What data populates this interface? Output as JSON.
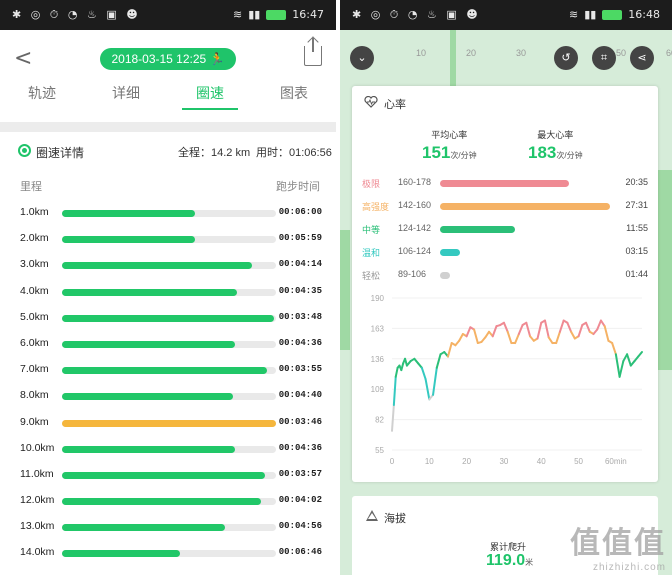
{
  "left": {
    "status_time": "16:47",
    "datetime": "2018-03-15 12:25",
    "tabs": [
      {
        "label": "轨迹",
        "active": false
      },
      {
        "label": "详细",
        "active": false
      },
      {
        "label": "圈速",
        "active": true
      },
      {
        "label": "图表",
        "active": false
      }
    ],
    "summary": {
      "title": "圈速详情",
      "total": "全程：14.2 km",
      "duration": "用时：01:06:56"
    },
    "col_left": "里程",
    "col_right": "跑步时间",
    "laps": [
      {
        "km": "1.0km",
        "time": "00:06:00",
        "pct": 62,
        "slow": false
      },
      {
        "km": "2.0km",
        "time": "00:05:59",
        "pct": 62,
        "slow": false
      },
      {
        "km": "3.0km",
        "time": "00:04:14",
        "pct": 89,
        "slow": false
      },
      {
        "km": "4.0km",
        "time": "00:04:35",
        "pct": 82,
        "slow": false
      },
      {
        "km": "5.0km",
        "time": "00:03:48",
        "pct": 99,
        "slow": false
      },
      {
        "km": "6.0km",
        "time": "00:04:36",
        "pct": 81,
        "slow": false
      },
      {
        "km": "7.0km",
        "time": "00:03:55",
        "pct": 96,
        "slow": false
      },
      {
        "km": "8.0km",
        "time": "00:04:40",
        "pct": 80,
        "slow": false
      },
      {
        "km": "9.0km",
        "time": "00:03:46",
        "pct": 100,
        "slow": true
      },
      {
        "km": "10.0km",
        "time": "00:04:36",
        "pct": 81,
        "slow": false
      },
      {
        "km": "11.0km",
        "time": "00:03:57",
        "pct": 95,
        "slow": false
      },
      {
        "km": "12.0km",
        "time": "00:04:02",
        "pct": 93,
        "slow": false
      },
      {
        "km": "13.0km",
        "time": "00:04:56",
        "pct": 76,
        "slow": false
      },
      {
        "km": "14.0km",
        "time": "00:06:46",
        "pct": 55,
        "slow": false
      }
    ]
  },
  "right": {
    "status_time": "16:48",
    "map_ticks": [
      "10",
      "20",
      "30",
      "40",
      "50",
      "60"
    ],
    "hr_title": "心率",
    "avg_label": "平均心率",
    "avg_value": "151",
    "max_label": "最大心率",
    "max_value": "183",
    "unit": "次/分钟",
    "zones": [
      {
        "name": "极限",
        "range": "160-178",
        "time": "20:35",
        "pct": 76,
        "color": "#ef8a93"
      },
      {
        "name": "高强度",
        "range": "142-160",
        "time": "27:31",
        "pct": 100,
        "color": "#f5b265"
      },
      {
        "name": "中等",
        "range": "124-142",
        "time": "11:55",
        "pct": 44,
        "color": "#2bbf78"
      },
      {
        "name": "温和",
        "range": "106-124",
        "time": "03:15",
        "pct": 12,
        "color": "#34c9c0"
      },
      {
        "name": "轻松",
        "range": "89-106",
        "time": "01:44",
        "pct": 6,
        "color": "#d0d0d0"
      }
    ],
    "chart_data": {
      "type": "line",
      "title": "",
      "xlabel": "",
      "ylabel": "",
      "x_ticks": [
        "0",
        "10",
        "20",
        "30",
        "40",
        "50",
        "60min"
      ],
      "y_ticks": [
        "190",
        "163",
        "136",
        "109",
        "82",
        "55"
      ],
      "ylim": [
        55,
        190
      ],
      "xlim": [
        0,
        67
      ],
      "series": [
        {
          "x": [
            0,
            0.5,
            1,
            1.5,
            2,
            2.5,
            3,
            3.5,
            4,
            5,
            6,
            7,
            8,
            9,
            10,
            11,
            12,
            13,
            14,
            15,
            16,
            17,
            18,
            19,
            20,
            21,
            22,
            23,
            24,
            25,
            26,
            27,
            28,
            29,
            30,
            31,
            32,
            33,
            34,
            35,
            36,
            37,
            38,
            39,
            40,
            41,
            42,
            43,
            44,
            45,
            46,
            47,
            48,
            49,
            50,
            51,
            52,
            53,
            54,
            55,
            56,
            57,
            58,
            59,
            60,
            61,
            62,
            63,
            64,
            65,
            66,
            67
          ],
          "y": [
            72,
            95,
            120,
            128,
            130,
            126,
            132,
            136,
            130,
            134,
            136,
            132,
            128,
            118,
            100,
            104,
            128,
            140,
            142,
            138,
            150,
            148,
            152,
            158,
            156,
            164,
            162,
            150,
            151,
            155,
            160,
            156,
            165,
            166,
            168,
            160,
            150,
            150,
            158,
            166,
            168,
            156,
            152,
            154,
            168,
            170,
            155,
            150,
            150,
            160,
            170,
            168,
            160,
            154,
            156,
            166,
            168,
            160,
            158,
            162,
            170,
            165,
            152,
            150,
            140,
            120,
            134,
            140,
            130,
            134,
            138,
            142
          ]
        }
      ]
    },
    "alt_title": "海拔",
    "ascent_label": "累计爬升",
    "ascent_value": "119.0",
    "ascent_unit": "米",
    "watermark": "值值值",
    "watermark_url": "zhizhizhi.com"
  }
}
